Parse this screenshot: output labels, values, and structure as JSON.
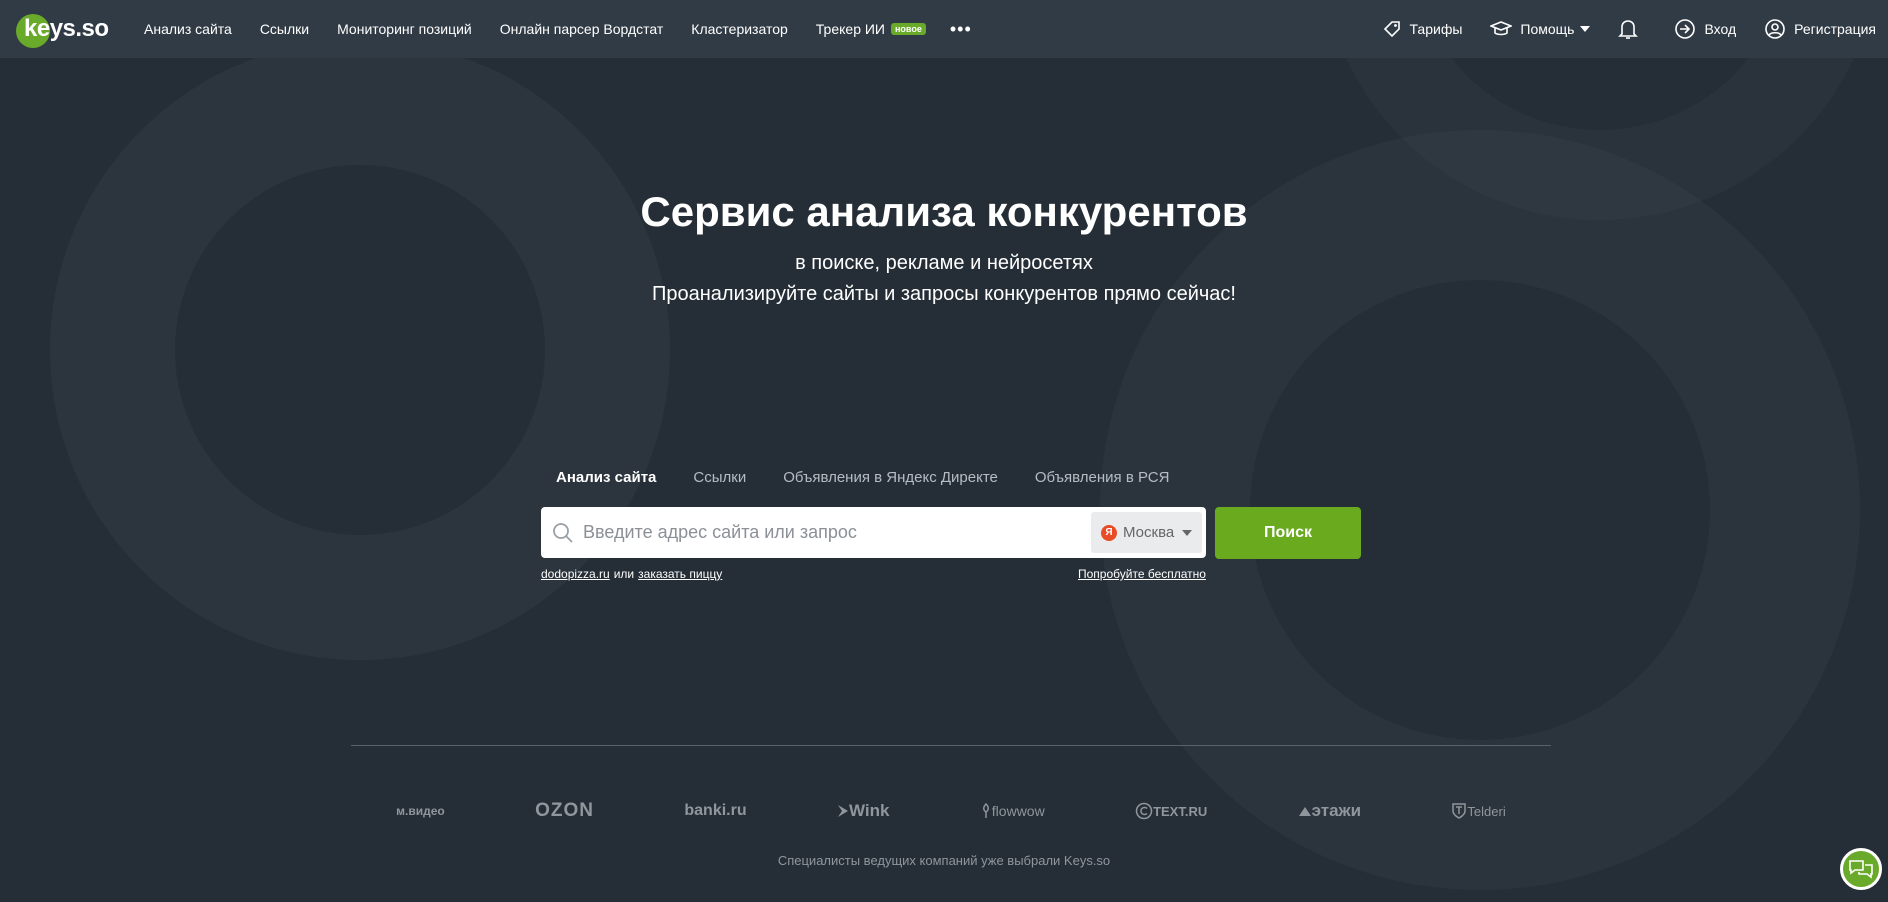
{
  "logo": {
    "text": "keys.so"
  },
  "nav": {
    "items": [
      {
        "label": "Анализ сайта"
      },
      {
        "label": "Ссылки"
      },
      {
        "label": "Мониторинг позиций"
      },
      {
        "label": "Онлайн парсер Вордстат"
      },
      {
        "label": "Кластеризатор"
      },
      {
        "label": "Трекер ИИ",
        "badge": "новое"
      }
    ],
    "more": "•••"
  },
  "right_nav": {
    "tariffs": "Тарифы",
    "help": "Помощь",
    "login": "Вход",
    "register": "Регистрация"
  },
  "hero": {
    "title": "Сервис анализа конкурентов",
    "subtitle": "в поиске, рекламе и нейросетях",
    "cta_text": "Проанализируйте сайты и запросы конкурентов прямо сейчас!"
  },
  "tabs": [
    {
      "label": "Анализ сайта",
      "active": true
    },
    {
      "label": "Ссылки"
    },
    {
      "label": "Объявления в Яндекс Директе"
    },
    {
      "label": "Объявления в РСЯ"
    }
  ],
  "search": {
    "placeholder": "Введите адрес сайта или запрос",
    "value": "",
    "region_icon": "Я",
    "region": "Москва",
    "button": "Поиск",
    "example1": "dodopizza.ru",
    "or": "или",
    "example2": "заказать пиццу",
    "try_free": "Попробуйте бесплатно"
  },
  "brands": [
    "м.видео",
    "OZON",
    "banki.ru",
    "Wink",
    "flowwow",
    "TEXT.RU",
    "этажи",
    "Telderi"
  ],
  "footer_note": "Специалисты ведущих компаний уже выбрали Keys.so",
  "colors": {
    "background": "#252e37",
    "header": "#313b45",
    "accent": "#6aaa1f"
  }
}
